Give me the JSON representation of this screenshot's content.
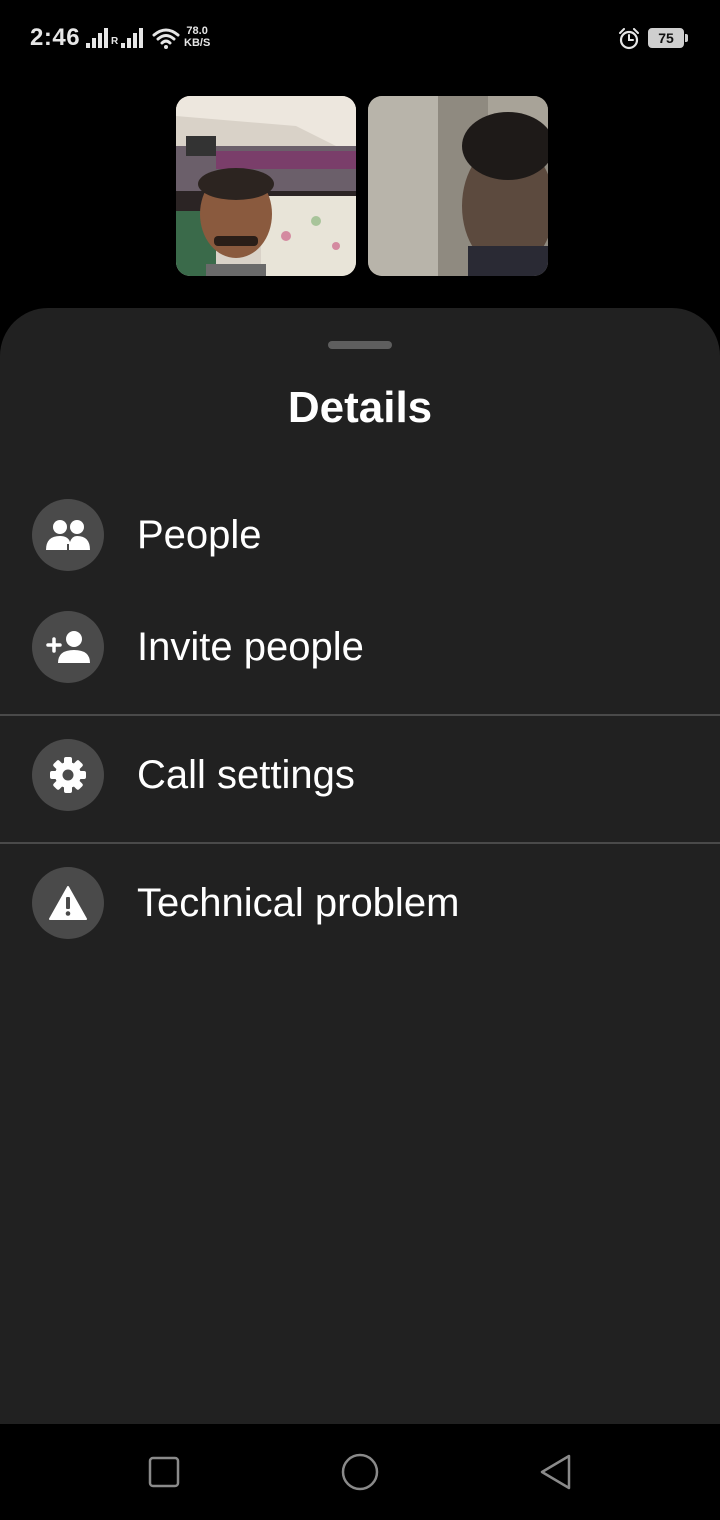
{
  "status_bar": {
    "time": "2:46",
    "roaming_label": "R",
    "network_speed_value": "78.0",
    "network_speed_unit": "KB/S",
    "battery_level": "75",
    "icons": [
      "signal-icon",
      "signal-icon",
      "wifi-icon",
      "alarm-icon",
      "battery-icon"
    ]
  },
  "video_tiles": [
    {
      "name": "participant-video-1"
    },
    {
      "name": "participant-video-2"
    }
  ],
  "sheet": {
    "title": "Details",
    "items": [
      {
        "label": "People",
        "icon": "people-icon"
      },
      {
        "label": "Invite people",
        "icon": "add-person-icon"
      },
      {
        "label": "Call settings",
        "icon": "gear-icon"
      },
      {
        "label": "Technical problem",
        "icon": "warning-icon"
      }
    ]
  },
  "nav_bar": {
    "buttons": [
      "recents-button",
      "home-button",
      "back-button"
    ]
  },
  "colors": {
    "sheet_background": "#212121",
    "icon_circle": "#4a4a4a",
    "divider": "#4a4a4a",
    "text": "#ffffff"
  }
}
